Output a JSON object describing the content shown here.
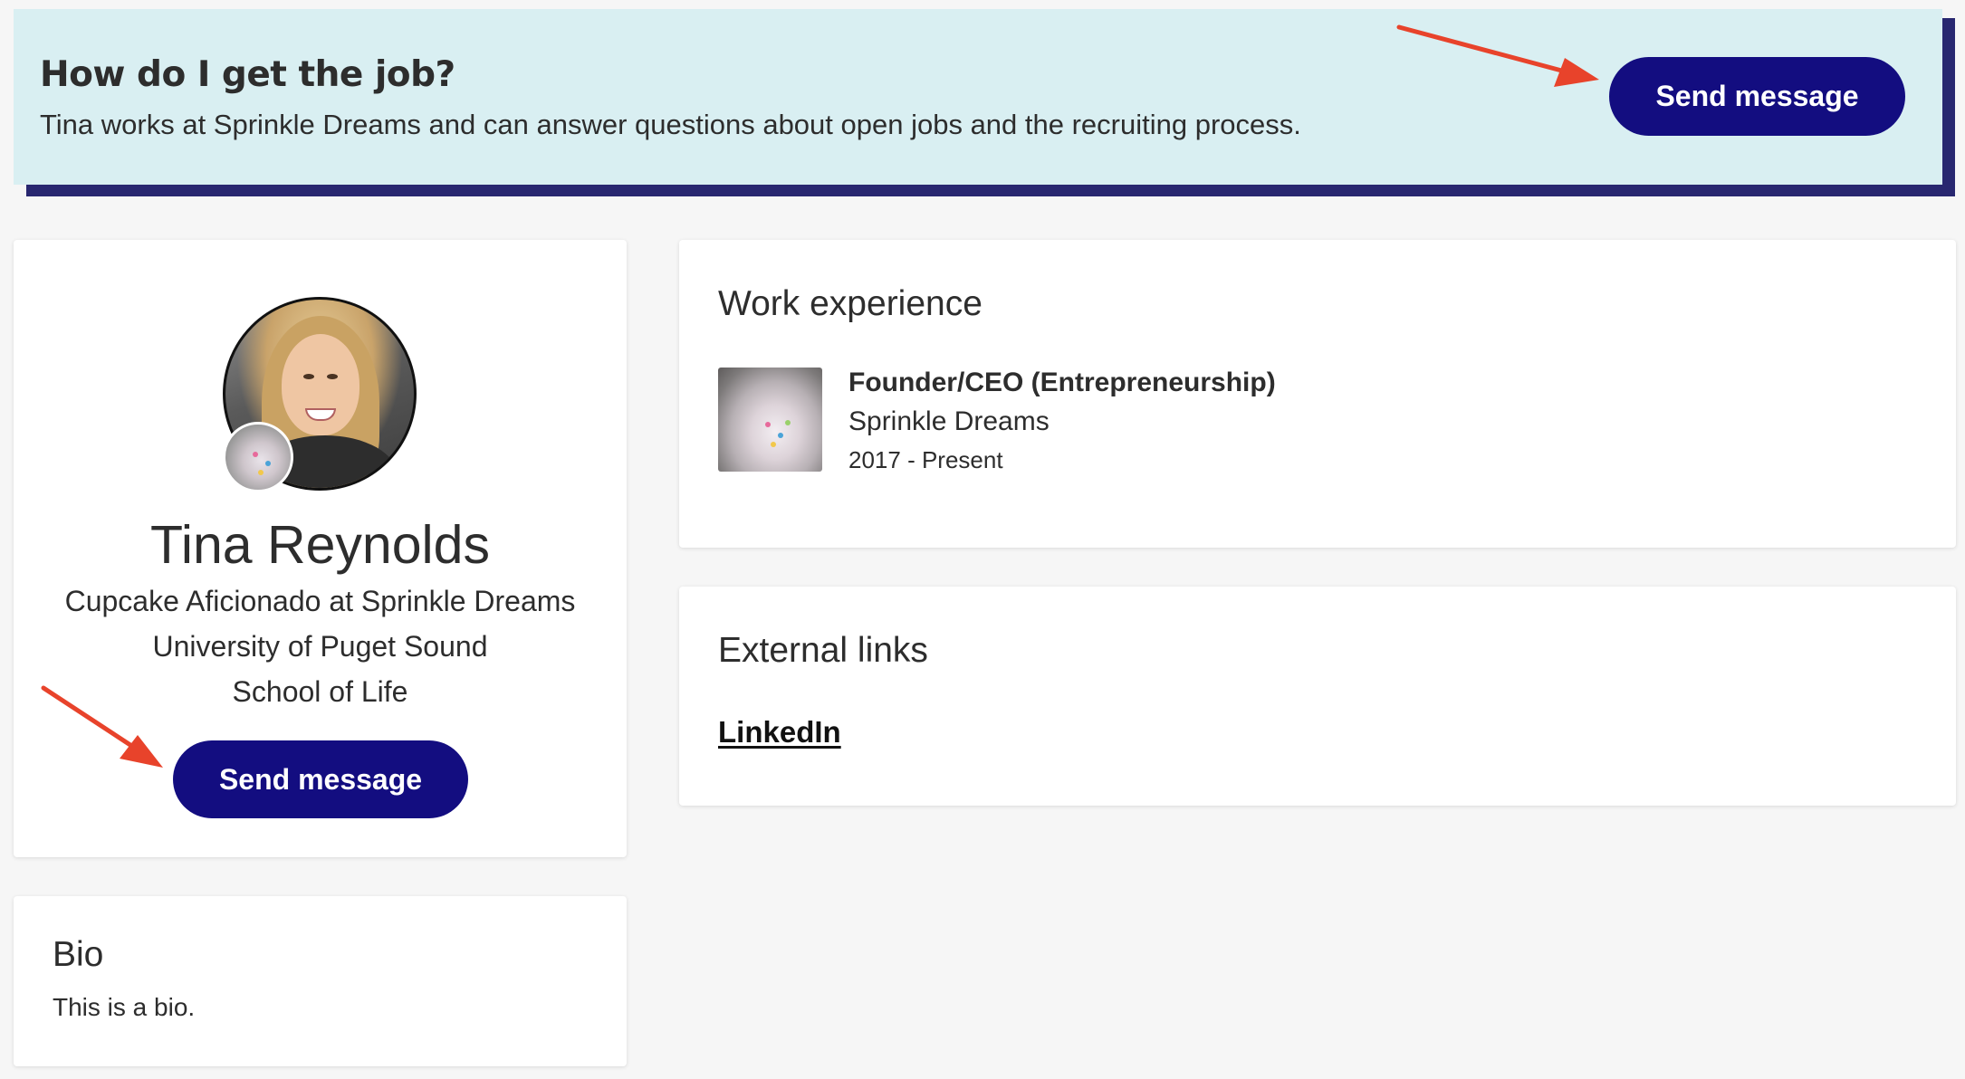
{
  "banner": {
    "title": "How do I get the job?",
    "description": "Tina works at Sprinkle Dreams and can answer questions about open jobs and the recruiting process.",
    "button_label": "Send message"
  },
  "profile": {
    "name": "Tina Reynolds",
    "headline": "Cupcake Aficionado at Sprinkle Dreams",
    "education_1": "University of Puget Sound",
    "education_2": "School of Life",
    "button_label": "Send message"
  },
  "bio": {
    "title": "Bio",
    "text": "This is a bio."
  },
  "work": {
    "title": "Work experience",
    "jobs": [
      {
        "role": "Founder/CEO (Entrepreneurship)",
        "company": "Sprinkle Dreams",
        "dates": "2017 - Present"
      }
    ]
  },
  "links": {
    "title": "External links",
    "items": [
      {
        "label": "LinkedIn"
      }
    ]
  },
  "colors": {
    "primary_button": "#130d80",
    "banner_bg": "#d9eff2",
    "banner_shadow": "#282770",
    "page_bg": "#f6f6f6",
    "annotation_arrow": "#e8432b"
  },
  "icons": {
    "annotation": "arrow-icon"
  }
}
